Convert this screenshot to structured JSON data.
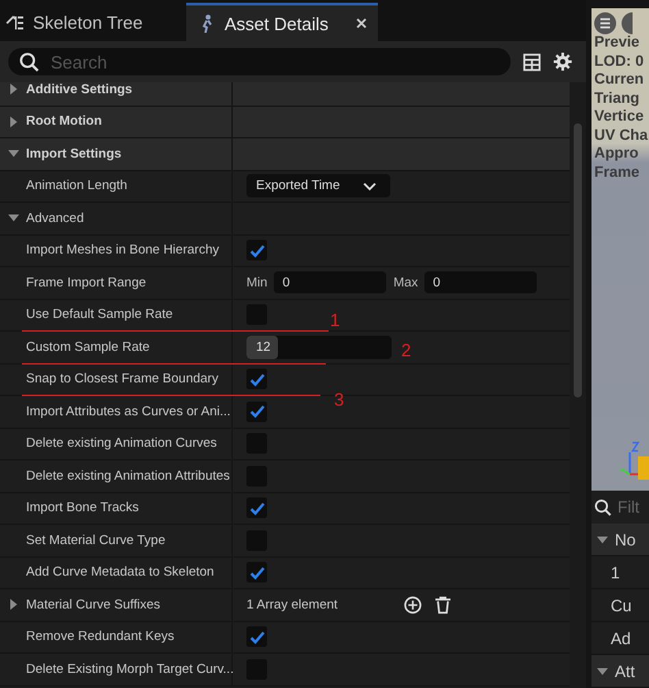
{
  "tabs": [
    {
      "label": "Skeleton Tree",
      "selected": false
    },
    {
      "label": "Asset Details",
      "selected": true
    }
  ],
  "search": {
    "placeholder": "Search"
  },
  "rows": [
    {
      "kind": "section",
      "label": "Additive Settings",
      "expanded": false
    },
    {
      "kind": "section",
      "label": "Root Motion",
      "expanded": false
    },
    {
      "kind": "section",
      "label": "Import Settings",
      "expanded": true
    },
    {
      "kind": "dropdown",
      "label": "Animation Length",
      "value": "Exported Time"
    },
    {
      "kind": "subsection",
      "label": "Advanced",
      "expanded": true
    },
    {
      "kind": "checkbox",
      "label": "Import Meshes in Bone Hierarchy",
      "checked": true
    },
    {
      "kind": "range",
      "label": "Frame Import Range",
      "min_label": "Min",
      "min_value": "0",
      "max_label": "Max",
      "max_value": "0"
    },
    {
      "kind": "checkbox",
      "label": "Use Default Sample Rate",
      "checked": false,
      "mark": "1"
    },
    {
      "kind": "number",
      "label": "Custom Sample Rate",
      "value": "12",
      "mark": "2"
    },
    {
      "kind": "checkbox",
      "label": "Snap to Closest Frame Boundary",
      "checked": true,
      "mark": "3"
    },
    {
      "kind": "checkbox",
      "label": "Import Attributes as Curves or Ani...",
      "checked": true
    },
    {
      "kind": "checkbox",
      "label": "Delete existing Animation Curves",
      "checked": false
    },
    {
      "kind": "checkbox",
      "label": "Delete existing Animation Attributes",
      "checked": false
    },
    {
      "kind": "checkbox",
      "label": "Import Bone Tracks",
      "checked": true
    },
    {
      "kind": "checkbox",
      "label": "Set Material Curve Type",
      "checked": false
    },
    {
      "kind": "checkbox",
      "label": "Add Curve Metadata to Skeleton",
      "checked": true
    },
    {
      "kind": "array",
      "label": "Material Curve Suffixes",
      "expanded": false,
      "value": "1 Array element"
    },
    {
      "kind": "checkbox",
      "label": "Remove Redundant Keys",
      "checked": true
    },
    {
      "kind": "checkbox",
      "label": "Delete Existing Morph Target Curv...",
      "checked": false
    }
  ],
  "viewport": {
    "stats": [
      "Previe",
      "LOD: 0",
      "Curren",
      "Triang",
      "Vertice",
      "UV Cha",
      "Appro",
      "Frame"
    ]
  },
  "side_panel": {
    "filter_placeholder": "Filt",
    "rows": [
      {
        "kind": "section",
        "label": "No",
        "expanded": true
      },
      {
        "kind": "value",
        "label": "1"
      },
      {
        "kind": "value",
        "label": "Cu"
      },
      {
        "kind": "value",
        "label": "Ad"
      },
      {
        "kind": "section",
        "label": "Att",
        "expanded": true
      }
    ]
  }
}
